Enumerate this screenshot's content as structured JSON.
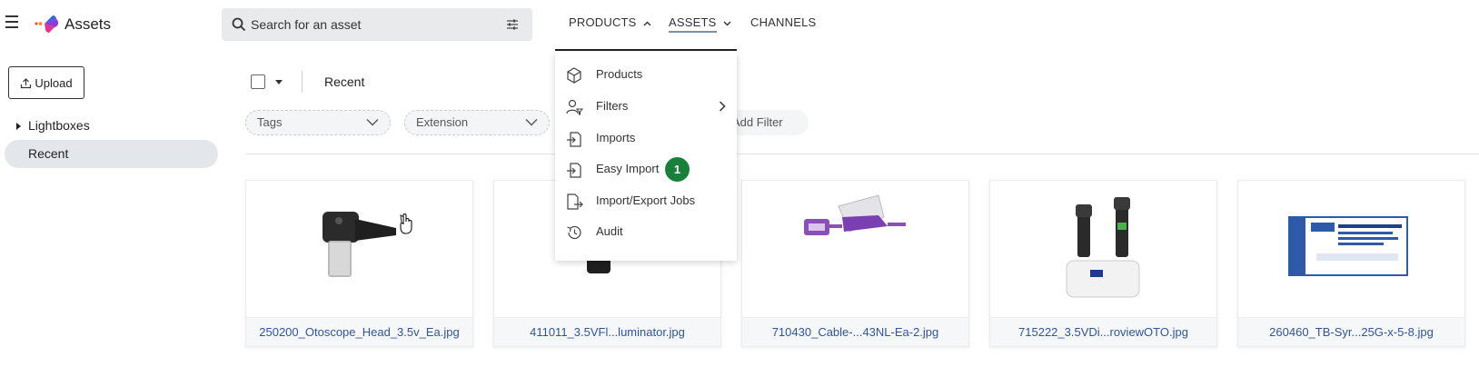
{
  "app": {
    "title": "Assets"
  },
  "search": {
    "placeholder": "Search for an asset"
  },
  "nav": {
    "products": "PRODUCTS",
    "assets": "ASSETS",
    "channels": "CHANNELS"
  },
  "sidebar": {
    "upload_label": "Upload",
    "items": [
      {
        "label": "Lightboxes"
      },
      {
        "label": "Recent"
      }
    ]
  },
  "toolbar": {
    "view_label": "Recent",
    "filters": [
      {
        "label": "Tags"
      },
      {
        "label": "Extension"
      }
    ],
    "add_filter_label": "Add Filter"
  },
  "products_menu": {
    "items": [
      {
        "label": "Products",
        "icon": "cube-icon"
      },
      {
        "label": "Filters",
        "icon": "user-filter-icon"
      },
      {
        "label": "Imports",
        "icon": "import-icon"
      },
      {
        "label": "Easy Import",
        "icon": "import-icon",
        "badge": "1"
      },
      {
        "label": "Import/Export Jobs",
        "icon": "import-export-icon"
      },
      {
        "label": "Audit",
        "icon": "history-icon"
      }
    ],
    "badge_color": "#1b7f3c"
  },
  "assets": [
    {
      "filename": "250200_Otoscope_Head_3.5v_Ea.jpg"
    },
    {
      "filename": "411011_3.5VFl...luminator.jpg"
    },
    {
      "filename": "710430_Cable-...43NL-Ea-2.jpg"
    },
    {
      "filename": "715222_3.5VDi...roviewOTO.jpg"
    },
    {
      "filename": "260460_TB-Syr...25G-x-5-8.jpg"
    }
  ],
  "colors": {
    "link": "#2f5596",
    "selected_bg": "#e3e6ea"
  }
}
